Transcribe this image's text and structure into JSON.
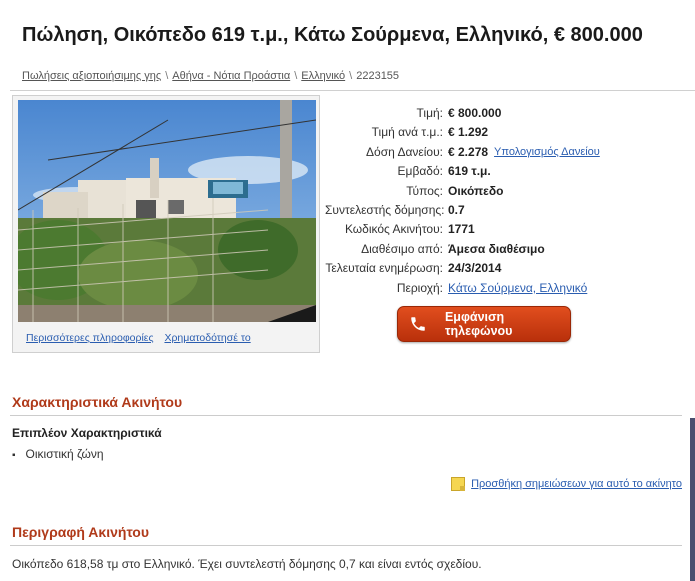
{
  "page": {
    "title": "Πώληση, Οικόπεδο 619 τ.μ., Κάτω Σούρμενα, Ελληνικό, € 800.000"
  },
  "breadcrumb": {
    "items": [
      "Πωλήσεις αξιοποιήσιμης γης",
      "Αθήνα - Νότια Προάστια",
      "Ελληνικό"
    ],
    "last": "2223155",
    "separator": "\\"
  },
  "photo": {
    "more_info_link": "Περισσότερες πληροφορίες",
    "finance_link": "Χρηματοδότησέ το"
  },
  "details": {
    "price_label": "Τιμή:",
    "price_value": "€ 800.000",
    "price_per_sqm_label": "Τιμή ανά τ.μ.:",
    "price_per_sqm_value": "€ 1.292",
    "loan_label": "Δόση Δανείου:",
    "loan_value": "€ 2.278",
    "loan_calc_link": "Υπολογισμός Δανείου",
    "area_label": "Εμβαδό:",
    "area_value": "619 τ.μ.",
    "type_label": "Τύπος:",
    "type_value": "Οικόπεδο",
    "coef_label": "Συντελεστής δόμησης:",
    "coef_value": "0.7",
    "code_label": "Κωδικός Ακινήτου:",
    "code_value": "1771",
    "avail_label": "Διαθέσιμο από:",
    "avail_value": "Άμεσα διαθέσιμο",
    "updated_label": "Τελευταία ενημέρωση:",
    "updated_value": "24/3/2014",
    "region_label": "Περιοχή:",
    "region_value": "Κάτω Σούρμενα, Ελληνικό"
  },
  "phone_button": {
    "label": "Εμφάνιση τηλεφώνου",
    "icon": "phone-icon"
  },
  "features": {
    "heading": "Χαρακτηριστικά Ακινήτου",
    "subheading": "Επιπλέον Χαρακτηριστικά",
    "items": [
      "Οικιστική ζώνη"
    ],
    "notes_link": "Προσθήκη σημειώσεων για αυτό το ακίνητο"
  },
  "description": {
    "heading": "Περιγραφή Ακινήτου",
    "text": "Οικόπεδο 618,58 τμ στο Ελληνικό. Έχει συντελεστή δόμησης 0,7 και είναι εντός σχεδίου."
  },
  "colors": {
    "accent": "#b03a1a",
    "link": "#2a5db0",
    "button": "#d0401a"
  }
}
